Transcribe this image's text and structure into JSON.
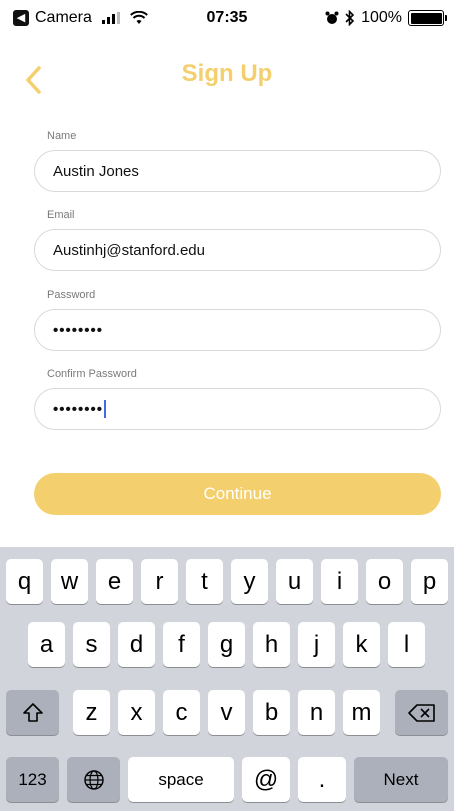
{
  "status_bar": {
    "app_name": "Camera",
    "time": "07:35",
    "battery": "100%",
    "alarm_icon": "alarm-clock-icon",
    "bluetooth_icon": "bluetooth-icon"
  },
  "nav": {
    "title": "Sign Up",
    "back_icon": "chevron-left-icon"
  },
  "form": {
    "name": {
      "label": "Name",
      "value": "Austin Jones"
    },
    "email": {
      "label": "Email",
      "value": "Austinhj@stanford.edu"
    },
    "password": {
      "label": "Password",
      "value": "••••••••"
    },
    "confirm_password": {
      "label": "Confirm Password",
      "value": "••••••••"
    },
    "continue_label": "Continue"
  },
  "keyboard": {
    "row1": [
      "q",
      "w",
      "e",
      "r",
      "t",
      "y",
      "u",
      "i",
      "o",
      "p"
    ],
    "row2": [
      "a",
      "s",
      "d",
      "f",
      "g",
      "h",
      "j",
      "k",
      "l"
    ],
    "row3": [
      "z",
      "x",
      "c",
      "v",
      "b",
      "n",
      "m"
    ],
    "numbers_label": "123",
    "space_label": "space",
    "at_label": "@",
    "period_label": ".",
    "next_label": "Next"
  },
  "colors": {
    "accent": "#f4cf6d",
    "caret": "#3b6fe0",
    "keyboard_bg": "#d1d4da"
  }
}
